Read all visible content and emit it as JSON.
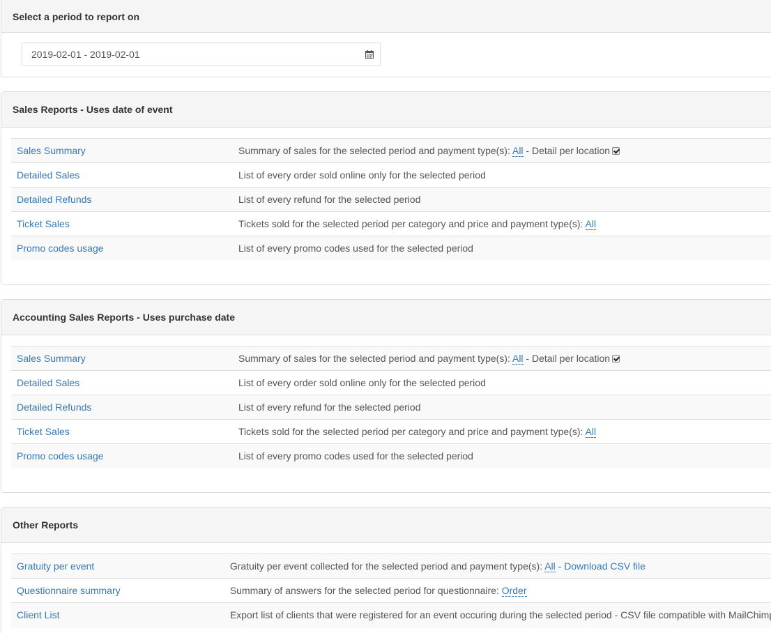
{
  "period": {
    "heading": "Select a period to report on",
    "range": "2019-02-01 - 2019-02-01",
    "icon": "calendar-icon"
  },
  "sales": {
    "heading": "Sales Reports - Uses date of event",
    "rows": [
      {
        "name": "Sales Summary",
        "desc": "Summary of sales for the selected period and payment type(s): ",
        "link": "All",
        "suffix": " - Detail per location",
        "checked": true
      },
      {
        "name": "Detailed Sales",
        "desc": "List of every order sold online only for the selected period"
      },
      {
        "name": "Detailed Refunds",
        "desc": "List of every refund for the selected period"
      },
      {
        "name": "Ticket Sales",
        "desc": "Tickets sold for the selected period per category and price and payment type(s): ",
        "link": "All"
      },
      {
        "name": "Promo codes usage",
        "desc": "List of every promo codes used for the selected period"
      }
    ]
  },
  "accounting": {
    "heading": "Accounting Sales Reports - Uses purchase date",
    "rows": [
      {
        "name": "Sales Summary",
        "desc": "Summary of sales for the selected period and payment type(s): ",
        "link": "All",
        "suffix": " - Detail per location",
        "checked": true
      },
      {
        "name": "Detailed Sales",
        "desc": "List of every order sold online only for the selected period"
      },
      {
        "name": "Detailed Refunds",
        "desc": "List of every refund for the selected period"
      },
      {
        "name": "Ticket Sales",
        "desc": "Tickets sold for the selected period per category and price and payment type(s): ",
        "link": "All"
      },
      {
        "name": "Promo codes usage",
        "desc": "List of every promo codes used for the selected period"
      }
    ]
  },
  "other": {
    "heading": "Other Reports",
    "rows": [
      {
        "name": "Gratuity per event",
        "desc": "Gratuity per event collected for the selected period and payment type(s): ",
        "link": "All",
        "sep": " - ",
        "extra_link": "Download CSV file"
      },
      {
        "name": "Questionnaire summary",
        "desc": "Summary of answers for the selected period for questionnaire: ",
        "link": "Order"
      },
      {
        "name": "Client List",
        "desc": "Export list of clients that were registered for an event occuring during the selected period - CSV file compatible with MailChimp."
      }
    ]
  },
  "colors": {
    "link": "#337ab7",
    "heading_bg": "#f5f5f5",
    "stripe": "#f9f9f9",
    "border": "#dddddd"
  }
}
